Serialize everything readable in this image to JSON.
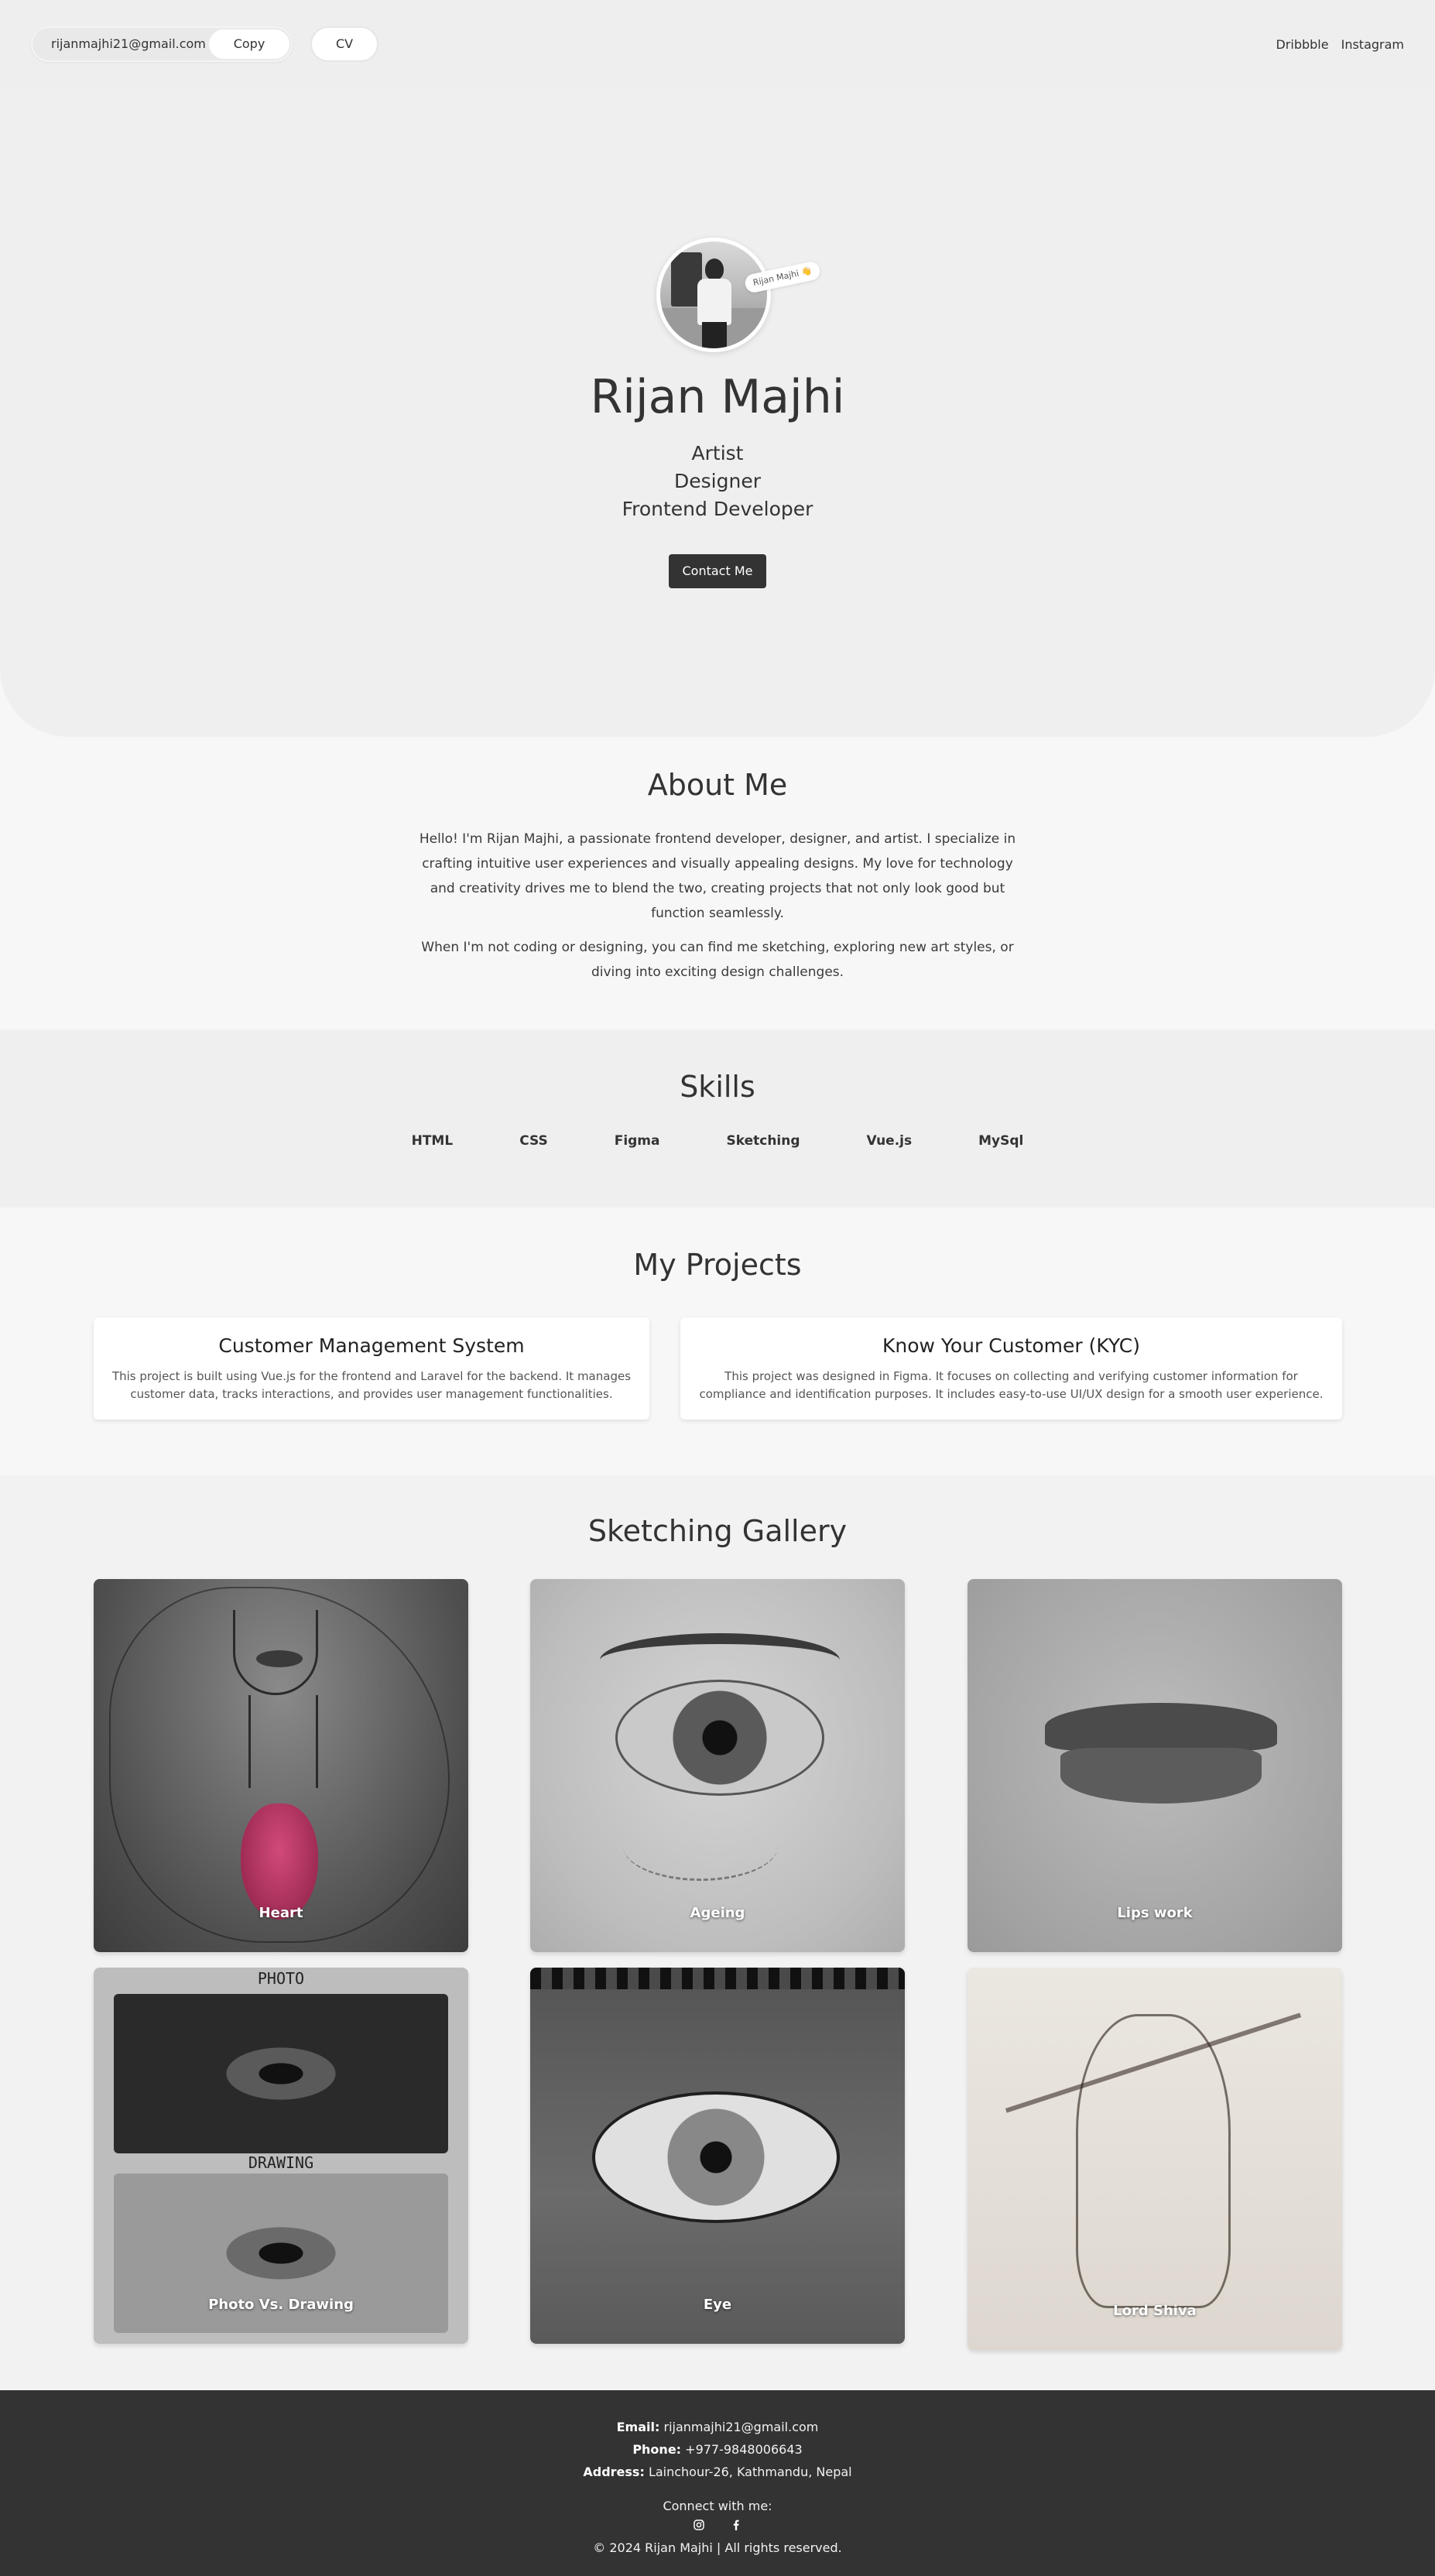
{
  "header": {
    "email": "rijanmajhi21@gmail.com",
    "copy_label": "Copy",
    "cv_label": "CV",
    "links": [
      "Dribbble",
      "Instagram"
    ]
  },
  "hero": {
    "name_tag": "Rijan Majhi 👋",
    "name": "Rijan Majhi",
    "roles": [
      "Artist",
      "Designer",
      "Frontend Developer"
    ],
    "contact_label": "Contact Me"
  },
  "about": {
    "title": "About Me",
    "paragraph1": "Hello! I'm Rijan Majhi, a passionate frontend developer, designer, and artist. I specialize in crafting intuitive user experiences and visually appealing designs. My love for technology and creativity drives me to blend the two, creating projects that not only look good but function seamlessly.",
    "paragraph2": "When I'm not coding or designing, you can find me sketching, exploring new art styles, or diving into exciting design challenges."
  },
  "skills": {
    "title": "Skills",
    "items": [
      "HTML",
      "CSS",
      "Figma",
      "Sketching",
      "Vue.js",
      "MySql"
    ]
  },
  "projects": {
    "title": "My Projects",
    "items": [
      {
        "title": "Customer Management System",
        "description": "This project is built using Vue.js for the frontend and Laravel for the backend. It manages customer data, tracks interactions, and provides user management functionalities."
      },
      {
        "title": "Know Your Customer (KYC)",
        "description": "This project was designed in Figma. It focuses on collecting and verifying customer information for compliance and identification purposes. It includes easy-to-use UI/UX design for a smooth user experience."
      }
    ]
  },
  "gallery": {
    "title": "Sketching Gallery",
    "items": [
      {
        "caption": "Heart"
      },
      {
        "caption": "Ageing"
      },
      {
        "caption": "Lips work"
      },
      {
        "caption": "Photo Vs. Drawing",
        "labels": [
          "PHOTO",
          "DRAWING"
        ]
      },
      {
        "caption": "Eye"
      },
      {
        "caption": "Lord Shiva"
      }
    ]
  },
  "footer": {
    "email_label": "Email:",
    "email": "rijanmajhi21@gmail.com",
    "phone_label": "Phone:",
    "phone": "+977-9848006643",
    "address_label": "Address:",
    "address": "Lainchour-26, Kathmandu, Nepal",
    "connect": "Connect with me:",
    "icons": [
      "instagram-icon",
      "facebook-icon"
    ],
    "copyright": "© 2024 Rijan Majhi | All rights reserved."
  },
  "colors": {
    "hero_bg": "#efefef",
    "dark": "#333333",
    "page_bg": "#f7f7f7"
  }
}
